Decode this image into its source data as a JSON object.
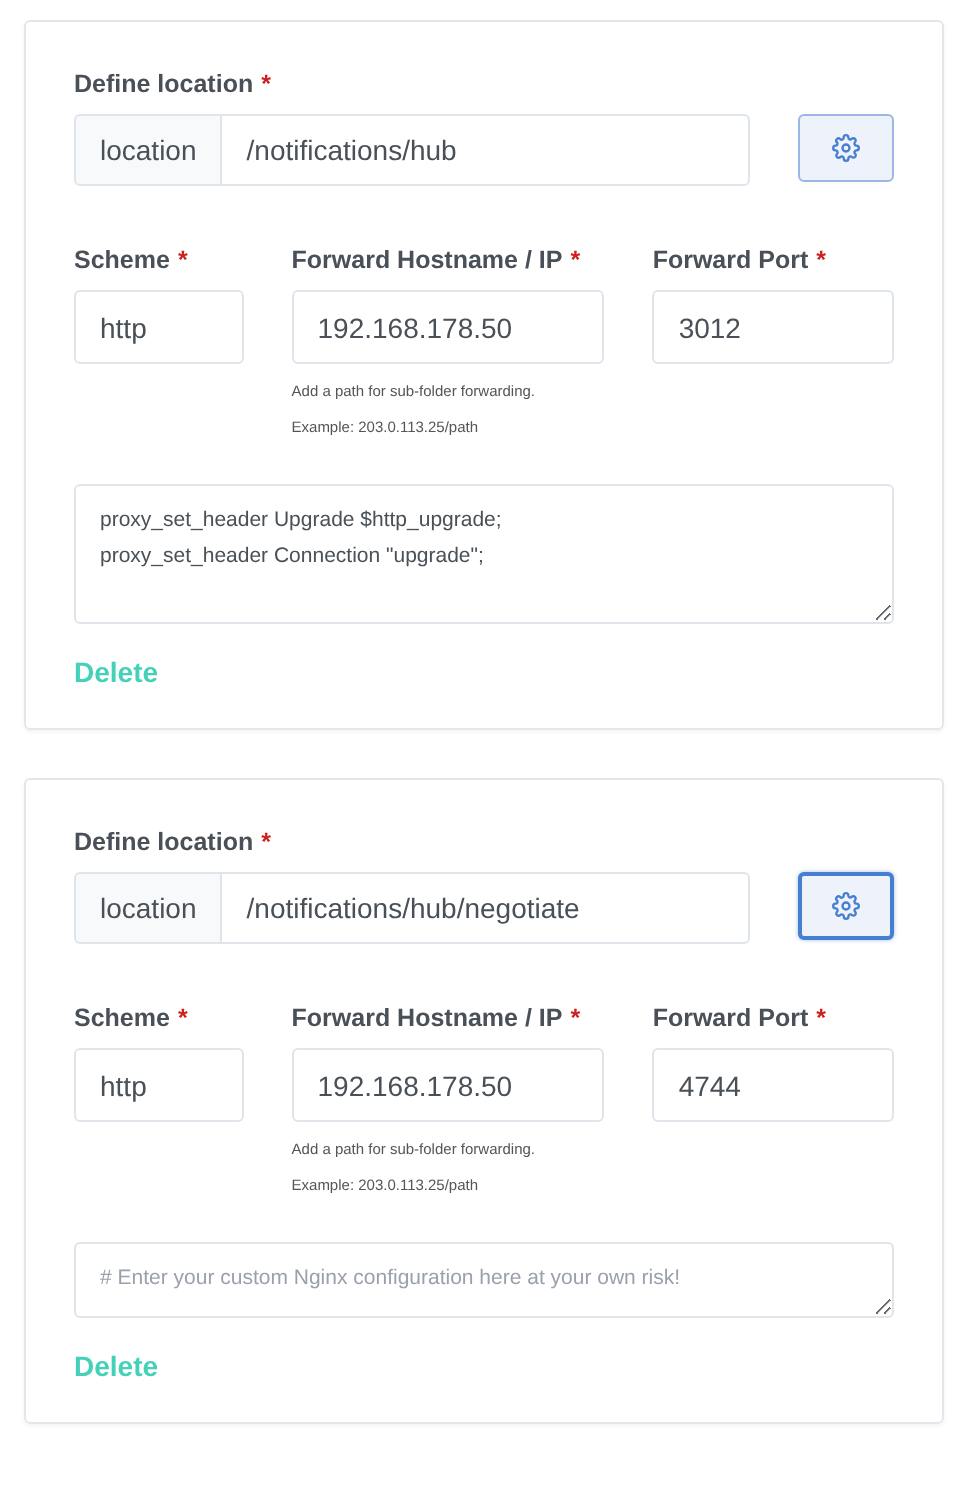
{
  "locations": [
    {
      "title": "Define location",
      "title_mark": "*",
      "prefix": "location",
      "path": "/notifications/hub",
      "advanced_focused": false,
      "fields": [
        {
          "label": "Scheme",
          "mark": "*",
          "value": "http"
        },
        {
          "label": "Forward Hostname / IP",
          "mark": "*",
          "value": "192.168.178.50",
          "help": [
            "Add a path for sub-folder forwarding.",
            "Example: 203.0.113.25/path"
          ]
        },
        {
          "label": "Forward Port",
          "mark": "*",
          "value": "3012"
        }
      ],
      "config": {
        "value": "proxy_set_header Upgrade $http_upgrade;\nproxy_set_header Connection \"upgrade\";"
      },
      "delete": "Delete"
    },
    {
      "title": "Define location",
      "title_mark": "*",
      "prefix": "location",
      "path": "/notifications/hub/negotiate",
      "advanced_focused": true,
      "fields": [
        {
          "label": "Scheme",
          "mark": "*",
          "value": "http"
        },
        {
          "label": "Forward Hostname / IP",
          "mark": "*",
          "value": "192.168.178.50",
          "help": [
            "Add a path for sub-folder forwarding.",
            "Example: 203.0.113.25/path"
          ]
        },
        {
          "label": "Forward Port",
          "mark": "*",
          "value": "4744"
        }
      ],
      "config": {
        "placeholder": "# Enter your custom Nginx configuration here at your own risk!"
      },
      "delete": "Delete"
    }
  ]
}
